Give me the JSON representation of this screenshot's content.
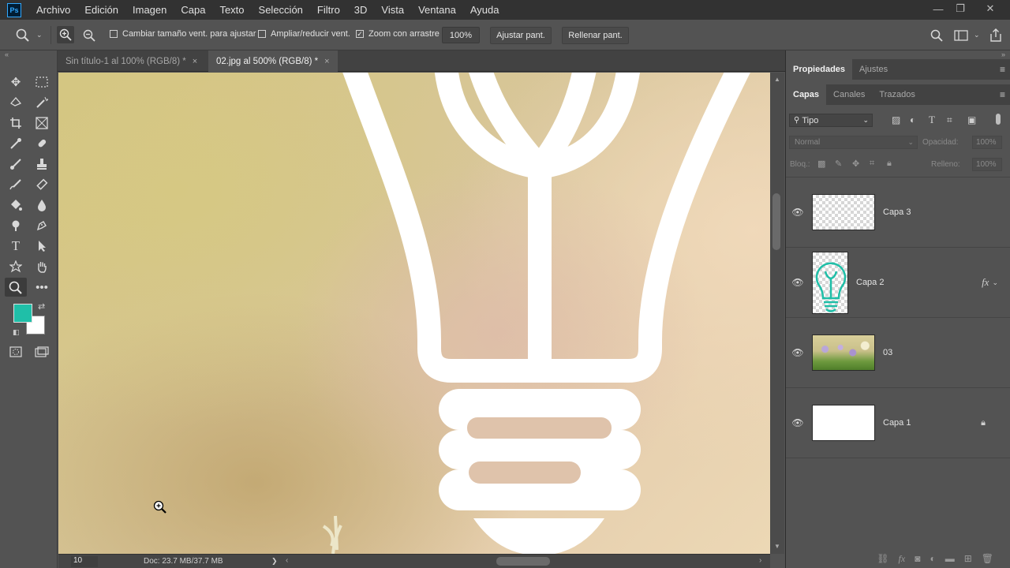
{
  "app": {
    "logo_text": "Ps"
  },
  "menu": [
    "Archivo",
    "Edición",
    "Imagen",
    "Capa",
    "Texto",
    "Selección",
    "Filtro",
    "3D",
    "Vista",
    "Ventana",
    "Ayuda"
  ],
  "window_controls": {
    "minimize": "—",
    "restore": "❐",
    "close": "✕"
  },
  "options_bar": {
    "resize_windows_label": "Cambiar tamaño vent. para ajustar",
    "resize_windows_checked": false,
    "zoom_all_label": "Ampliar/reducir vent.",
    "zoom_all_checked": false,
    "scrubby_zoom_label": "Zoom con arrastre",
    "scrubby_zoom_checked": true,
    "zoom_value": "100%",
    "fit_screen_label": "Ajustar pant.",
    "fill_screen_label": "Rellenar pant."
  },
  "tabs": [
    {
      "label": "Sin título-1 al 100% (RGB/8) *",
      "active": false,
      "close": "×"
    },
    {
      "label": "02.jpg al 500% (RGB/8) *",
      "active": true,
      "close": "×"
    }
  ],
  "colors": {
    "foreground": "#1fbfa8",
    "background": "#ffffff",
    "accent": "#31a8ff"
  },
  "status": {
    "zoom": "10",
    "doc": "Doc: 23.7 MB/37.7 MB",
    "arrow": "❯"
  },
  "properties_panel": {
    "tabs": [
      "Propiedades",
      "Ajustes"
    ],
    "active": "Propiedades"
  },
  "layers_panel": {
    "tabs": [
      "Capas",
      "Canales",
      "Trazados"
    ],
    "active": "Capas",
    "filter_label": "Tipo",
    "blend_mode": "Normal",
    "opacity_label": "Opacidad:",
    "opacity_value": "100%",
    "lock_label": "Bloq.:",
    "fill_label": "Relleno:",
    "fill_value": "100%",
    "fx_symbol": "fx",
    "layers": [
      {
        "name": "Capa 3",
        "visible": true,
        "thumb": "transparent"
      },
      {
        "name": "Capa 2",
        "visible": true,
        "thumb": "bulb",
        "fx": true
      },
      {
        "name": "03",
        "visible": true,
        "thumb": "photo"
      },
      {
        "name": "Capa 1",
        "visible": true,
        "thumb": "white",
        "locked": true
      }
    ]
  }
}
